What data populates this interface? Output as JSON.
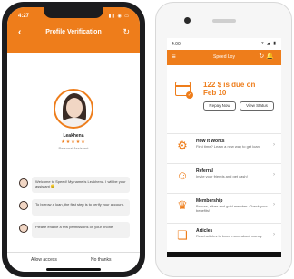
{
  "iphone": {
    "status": {
      "time": "4:27"
    },
    "header": {
      "title": "Profile Verification"
    },
    "agent": {
      "name": "Leakhena",
      "stars": "★★★★★",
      "role": "Personal Assistant"
    },
    "messages": [
      "Welcome to Speed! My name is Leakhena. I will be your assistant 😊",
      "To borrow a loan, the first step is to verify your account.",
      "Please enable a few permissions on your phone."
    ],
    "actions": {
      "allow": "Allow access",
      "deny": "No thanks"
    }
  },
  "android": {
    "status": {
      "time": "4:00"
    },
    "appbar": {
      "title": "Speed Loy"
    },
    "due": {
      "amount": "122 $ is due on",
      "date": "Feb 10",
      "repay_label": "Repay Now",
      "status_label": "View Status"
    },
    "menu": [
      {
        "title": "How It Works",
        "desc": "First time? Learn a new way to get loan",
        "icon": "gear-icon",
        "glyph": "⚙"
      },
      {
        "title": "Referral",
        "desc": "Invite your friends and get cash!",
        "icon": "referral-icon",
        "glyph": "👥"
      },
      {
        "title": "Membership",
        "desc": "Bronze, silver and gold member. Check your benefits!",
        "icon": "membership-icon",
        "glyph": "🏅"
      },
      {
        "title": "Articles",
        "desc": "Read articles to know more about money",
        "icon": "articles-icon",
        "glyph": "📖"
      }
    ]
  },
  "colors": {
    "accent": "#ee7d1b"
  }
}
